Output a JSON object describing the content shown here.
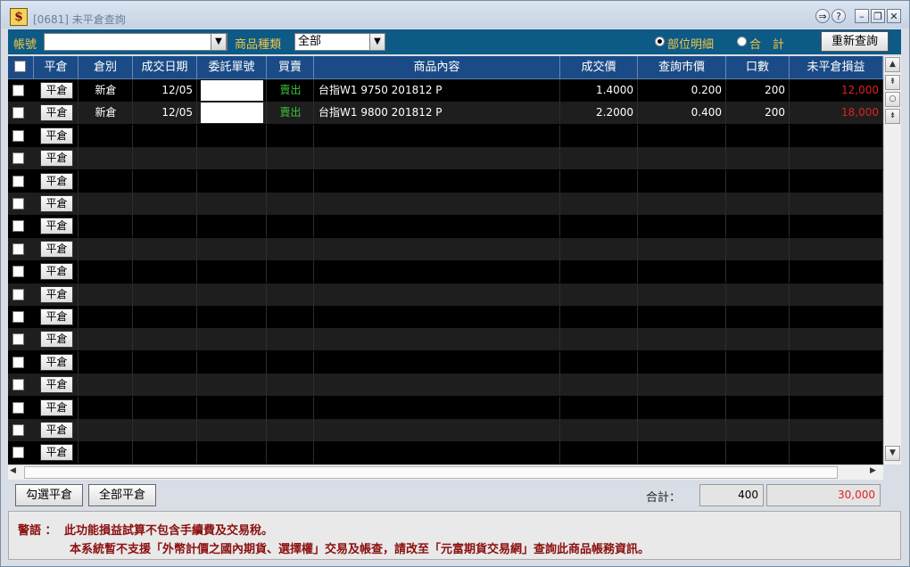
{
  "window": {
    "title": "[0681] 未平倉查詢",
    "app_icon": "$"
  },
  "toolbar": {
    "account_label": "帳號",
    "account_value": "",
    "category_label": "商品種類",
    "category_value": "全部",
    "radio_detail": "部位明細",
    "radio_total": "合　計",
    "requery_label": "重新查詢"
  },
  "grid": {
    "headers": [
      "平倉",
      "倉別",
      "成交日期",
      "委託單號",
      "買賣",
      "商品內容",
      "成交價",
      "查詢市價",
      "口數",
      "未平倉損益"
    ],
    "close_button_label": "平倉",
    "rows": [
      {
        "type": "新倉",
        "date": "12/05",
        "order_no": "",
        "side": "賣出",
        "product": "台指W1 9750 201812 P",
        "price": "1.4000",
        "market": "0.200",
        "qty": "200",
        "pnl": "12,000"
      },
      {
        "type": "新倉",
        "date": "12/05",
        "order_no": "",
        "side": "賣出",
        "product": "台指W1 9800 201812 P",
        "price": "2.2000",
        "market": "0.400",
        "qty": "200",
        "pnl": "18,000"
      }
    ],
    "empty_rows": 15
  },
  "footer": {
    "select_close_label": "勾選平倉",
    "all_close_label": "全部平倉",
    "total_label": "合計：",
    "total_qty": "400",
    "total_pnl": "30,000"
  },
  "notice": {
    "title": "警語 ：",
    "line1": "此功能損益試算不包含手續費及交易稅。",
    "line2": "本系統暫不支援「外幣計價之國內期貨、選擇權」交易及帳查，請改至「元富期貨交易網」查詢此商品帳務資訊。"
  },
  "colors": {
    "header_bg": "#1a4b86",
    "toolbar_bg": "#0d5a86",
    "label_gold": "#f2c744",
    "sell_green": "#3cc43c",
    "pnl_red": "#e02020",
    "notice_red": "#8b0f0f"
  }
}
